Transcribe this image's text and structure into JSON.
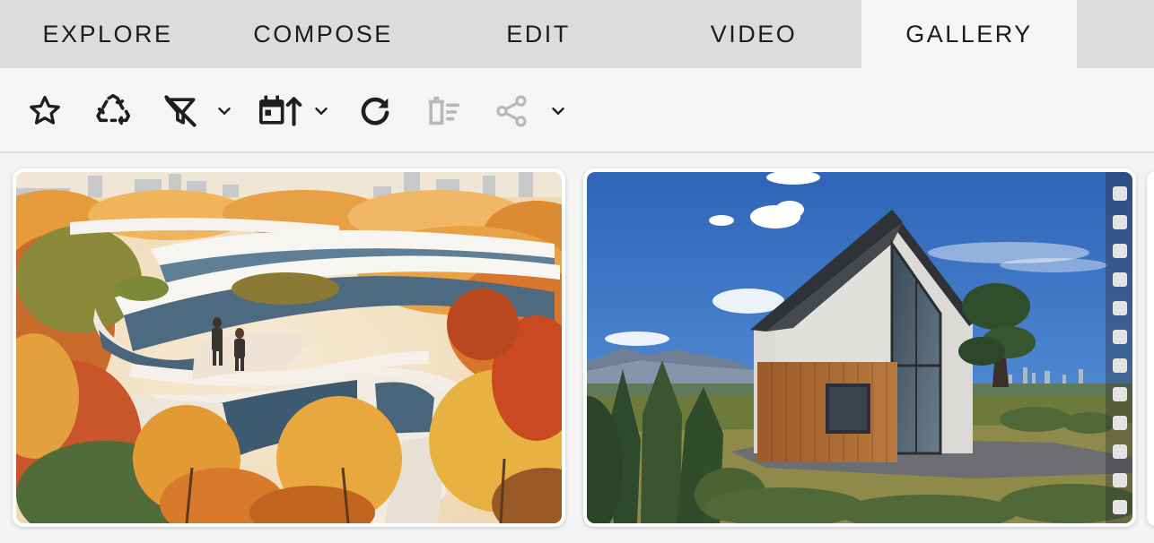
{
  "tabs": [
    {
      "label": "EXPLORE",
      "active": false
    },
    {
      "label": "COMPOSE",
      "active": false
    },
    {
      "label": "EDIT",
      "active": false
    },
    {
      "label": "VIDEO",
      "active": false
    },
    {
      "label": "GALLERY",
      "active": true
    }
  ],
  "toolbar": {
    "icons": [
      "star-icon",
      "recycle-icon",
      "filter-off-icon",
      "chevron-down-icon",
      "calendar-sort-icon",
      "chevron-down-icon",
      "refresh-icon",
      "delete-multiple-icon",
      "share-icon",
      "chevron-down-icon"
    ],
    "disabled": [
      "delete-multiple-icon",
      "share-icon"
    ]
  },
  "gallery": {
    "items": [
      {
        "subject": "watercolor-autumn-architecture"
      },
      {
        "subject": "modern-gabled-house"
      }
    ]
  },
  "colors": {
    "tab_bar": "#dcdcdc",
    "tab_active": "#f5f5f5",
    "toolbar": "#f5f5f5",
    "icon": "#1f1f1f",
    "icon_disabled": "#b8b8b8"
  }
}
